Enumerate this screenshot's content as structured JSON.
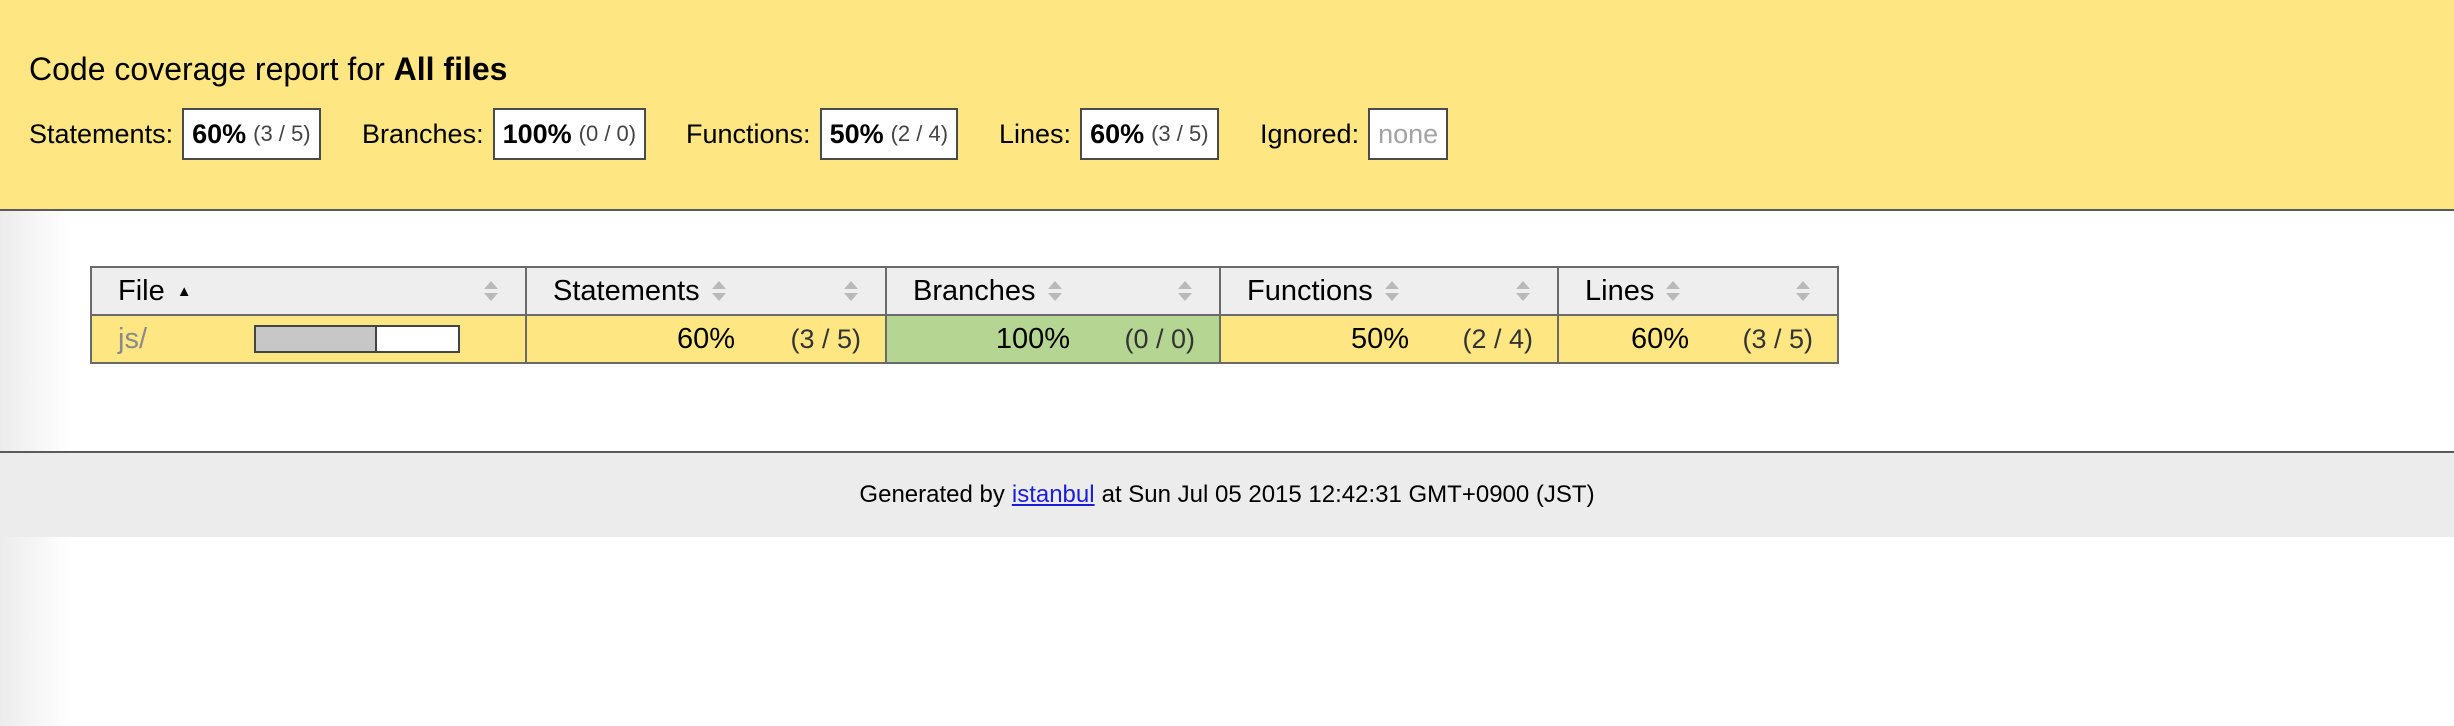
{
  "header": {
    "title_prefix": "Code coverage report for",
    "title_bold": "All files"
  },
  "summary": {
    "statements": {
      "label": "Statements:",
      "pct": "60%",
      "frac": "(3 / 5)"
    },
    "branches": {
      "label": "Branches:",
      "pct": "100%",
      "frac": "(0 / 0)"
    },
    "functions": {
      "label": "Functions:",
      "pct": "50%",
      "frac": "(2 / 4)"
    },
    "lines": {
      "label": "Lines:",
      "pct": "60%",
      "frac": "(3 / 5)"
    },
    "ignored": {
      "label": "Ignored:",
      "value": "none"
    }
  },
  "table": {
    "headers": [
      "File",
      "Statements",
      "Branches",
      "Functions",
      "Lines"
    ],
    "rows": [
      {
        "file": "js/",
        "coverage_bar_fraction": 0.6,
        "statements": {
          "pct": "60%",
          "frac": "(3 / 5)"
        },
        "branches": {
          "pct": "100%",
          "frac": "(0 / 0)"
        },
        "functions": {
          "pct": "50%",
          "frac": "(2 / 4)"
        },
        "lines": {
          "pct": "60%",
          "frac": "(3 / 5)"
        }
      }
    ]
  },
  "footer": {
    "prefix": "Generated by",
    "link_text": "istanbul",
    "suffix": "at Sun Jul 05 2015 12:42:31 GMT+0900 (JST)"
  },
  "colors": {
    "medium_coverage": "#fee783",
    "high_coverage": "#b5d592",
    "footer_bg": "#ececec",
    "link": "#1a1ed6"
  }
}
